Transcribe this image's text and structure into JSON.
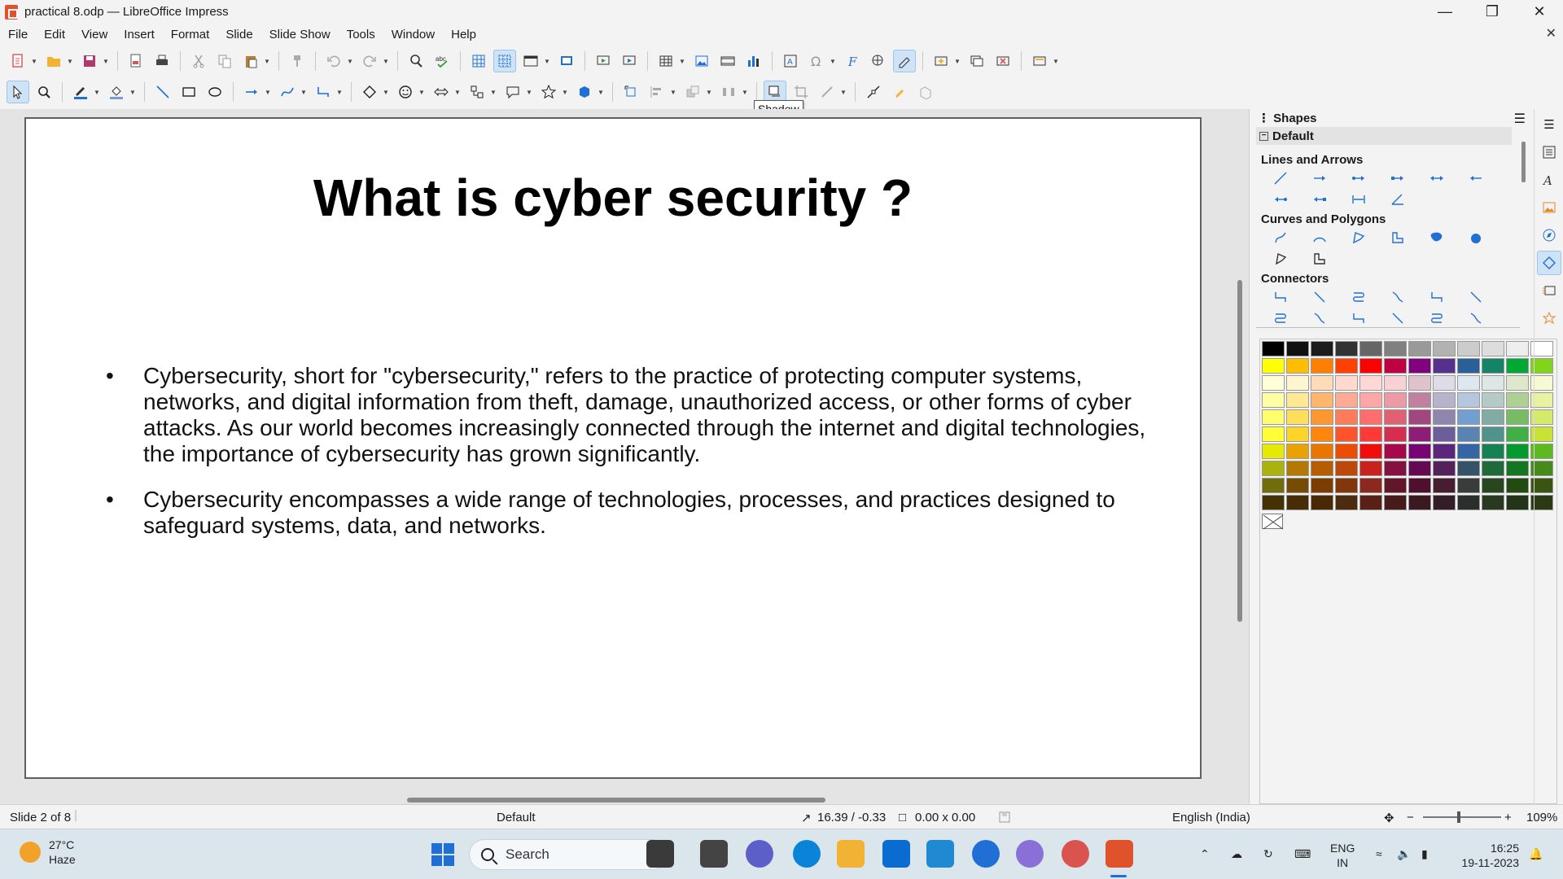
{
  "window": {
    "title": "practical 8.odp — LibreOffice Impress"
  },
  "menu": [
    "File",
    "Edit",
    "View",
    "Insert",
    "Format",
    "Slide",
    "Slide Show",
    "Tools",
    "Window",
    "Help"
  ],
  "tooltip": "Shadow",
  "slide": {
    "title": "What is cyber security ?",
    "bullets": [
      "Cybersecurity, short for \"cybersecurity,\" refers to the practice of protecting computer systems, networks, and digital information from theft, damage, unauthorized access, or other forms of cyber attacks. As our world becomes increasingly connected through the internet and digital technologies, the importance of cybersecurity has grown significantly.",
      "Cybersecurity encompasses a wide range of technologies, processes, and practices designed to safeguard systems, data, and networks."
    ]
  },
  "sidebar": {
    "title": "Shapes",
    "section": "Default",
    "categories": [
      "Lines and Arrows",
      "Curves and Polygons",
      "Connectors"
    ],
    "colors": [
      "#000000",
      "#111111",
      "#1c1c1c",
      "#333333",
      "#666666",
      "#808080",
      "#999999",
      "#b2b2b2",
      "#cccccc",
      "#dddddd",
      "#eeeeee",
      "#ffffff",
      "#ffff00",
      "#ffbf00",
      "#ff8000",
      "#ff4000",
      "#ff0000",
      "#bf0041",
      "#800080",
      "#55308d",
      "#2a6099",
      "#158466",
      "#00a933",
      "#81d41a",
      "#ffffd7",
      "#fff5ce",
      "#ffdbb6",
      "#ffd8ce",
      "#ffd7d7",
      "#f7d1d5",
      "#e0c2cd",
      "#dedce6",
      "#dee6ef",
      "#dee7e5",
      "#dde8cb",
      "#f6f9d4",
      "#ffffa6",
      "#ffe994",
      "#ffb66c",
      "#ffaa95",
      "#ffa6a6",
      "#ec9ba4",
      "#bf819e",
      "#b7b3ca",
      "#b4c7dc",
      "#b3cac7",
      "#afd095",
      "#e8f2a1",
      "#ffff6d",
      "#ffde59",
      "#ff972f",
      "#ff7b59",
      "#ff6d6d",
      "#e16173",
      "#a1467e",
      "#8e86ae",
      "#729fcf",
      "#81aca6",
      "#77bc65",
      "#d4ea6b",
      "#ffff38",
      "#ffd428",
      "#ff860d",
      "#ff5429",
      "#ff3838",
      "#d62e4e",
      "#8d1d75",
      "#6b5e9b",
      "#5983b0",
      "#50938a",
      "#3faf46",
      "#c9e236",
      "#e6e905",
      "#e8a202",
      "#ea7500",
      "#ed4c05",
      "#f10d0c",
      "#a7074b",
      "#780373",
      "#5b277d",
      "#3465a4",
      "#168253",
      "#069a2e",
      "#5eb91e",
      "#acb20c",
      "#b47804",
      "#b85c00",
      "#be480a",
      "#c9211e",
      "#861141",
      "#650953",
      "#55215b",
      "#355269",
      "#1e6a39",
      "#127622",
      "#468a1a",
      "#706e0c",
      "#784b04",
      "#7b3d00",
      "#813709",
      "#8d281e",
      "#611729",
      "#4e102d",
      "#481d32",
      "#383d3c",
      "#28471f",
      "#224b12",
      "#395511",
      "#443205",
      "#472c04",
      "#4a2801",
      "#4c2b0f",
      "#5a2016",
      "#461b19",
      "#3a1a20",
      "#331d26",
      "#2c2e2c",
      "#2a3a20",
      "#233516",
      "#2c3a13"
    ]
  },
  "status": {
    "slide": "Slide 2 of 8",
    "layout": "Default",
    "position": "16.39 / -0.33",
    "size": "0.00 x 0.00",
    "language": "English (India)",
    "zoom": "109%"
  },
  "taskbar": {
    "weather_temp": "27°C",
    "weather_desc": "Haze",
    "search": "Search",
    "lang1": "ENG",
    "lang2": "IN",
    "time": "16:25",
    "date": "19-11-2023"
  }
}
